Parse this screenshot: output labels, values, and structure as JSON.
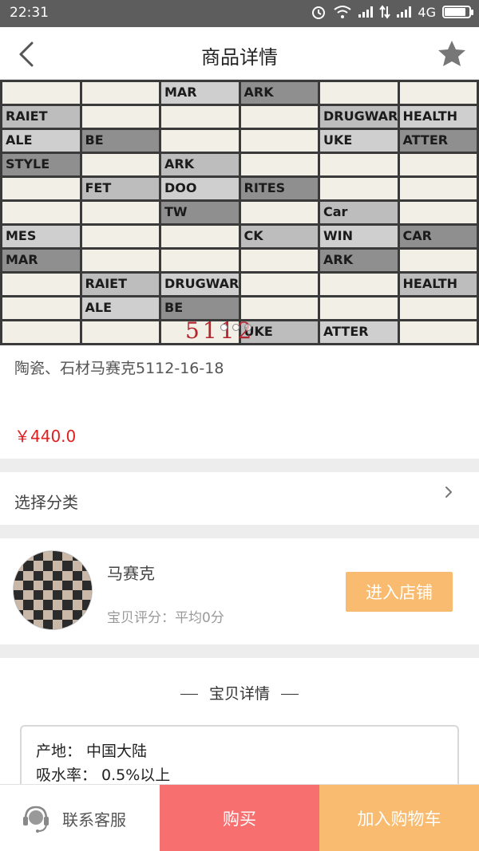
{
  "status_bar": {
    "time": "22:31",
    "network": "4G",
    "battery_level": 0.85
  },
  "header": {
    "title": "商品详情"
  },
  "product": {
    "name": "陶瓷、石材马赛克5112-16-18",
    "price": "￥440.0",
    "banner_code": "5112",
    "banner_tile_words": [
      "MAR",
      "ARK",
      "RAIET",
      "DRUGWAR",
      "HEALTH",
      "ALE",
      "BE",
      "UKE",
      "ATTER",
      "STYLE",
      "ARK",
      "FET",
      "DOO",
      "RITES",
      "TW",
      "Car",
      "MES",
      "CK",
      "WIN",
      "CAR"
    ],
    "banner_pages": 3,
    "banner_active_page": 0
  },
  "category": {
    "label": "选择分类"
  },
  "shop": {
    "name": "马赛克",
    "rating": "宝贝评分：平均0分",
    "enter_label": "进入店铺"
  },
  "details": {
    "heading": "宝贝详情",
    "specs": [
      {
        "line": "产地： 中国大陆"
      },
      {
        "line": "吸水率： 0.5%以上"
      }
    ]
  },
  "bottom_bar": {
    "service_label": "联系客服",
    "buy_label": "购买",
    "cart_label": "加入购物车"
  },
  "colors": {
    "price": "#e02020",
    "buy": "#f76f6f",
    "cart": "#f9bb6f",
    "enter": "#f9bb6f"
  },
  "icons": {
    "back": "chevron-left-icon",
    "favorite": "star-icon",
    "category": "chevron-right-icon",
    "service": "headset-icon"
  }
}
